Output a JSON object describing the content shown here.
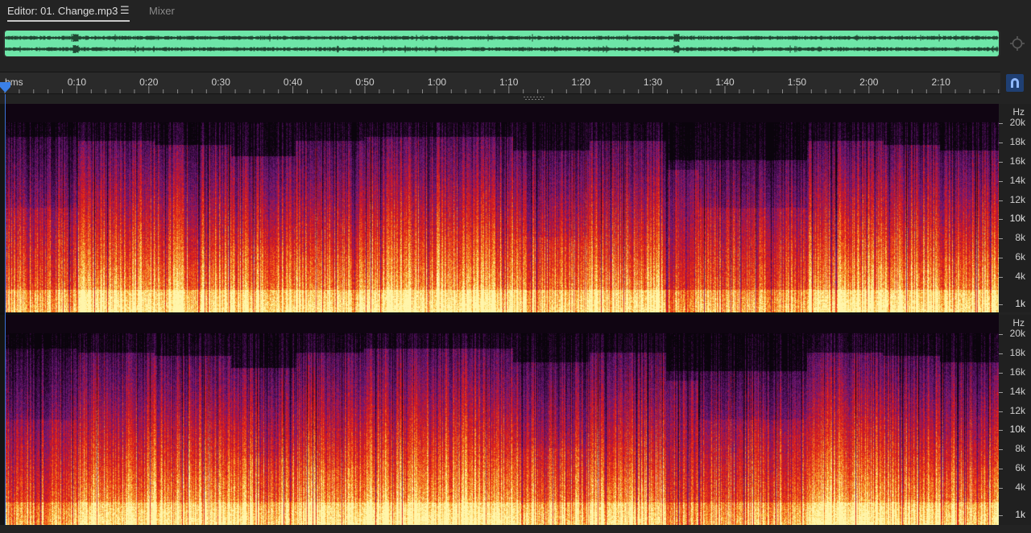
{
  "tabs": {
    "editor_label": "Editor: 01. Change.mp3",
    "menu_icon": "hamburger-menu-icon",
    "mixer_label": "Mixer"
  },
  "overview": {
    "wave_color": "#6ee6a8"
  },
  "ruler": {
    "unit_label": "hms",
    "labels": [
      "0:10",
      "0:20",
      "0:30",
      "0:40",
      "0:50",
      "1:00",
      "1:10",
      "1:20",
      "1:30",
      "1:40",
      "1:50",
      "2:00",
      "2:10"
    ]
  },
  "spectral": {
    "hz_unit": "Hz",
    "scale_labels": [
      "20k",
      "18k",
      "16k",
      "14k",
      "12k",
      "10k",
      "8k",
      "6k",
      "4k",
      "1k"
    ]
  },
  "colors": {
    "accent": "#3a73d8",
    "spectrum_low": "#fff2a0",
    "spectrum_mid": "#e8241a",
    "spectrum_high": "#6a1e8a",
    "background": "#141414"
  },
  "icons": {
    "zoom": "zoom-crosshair-icon",
    "snap": "magnet-snap-icon",
    "playhead": "playhead-marker-icon"
  }
}
